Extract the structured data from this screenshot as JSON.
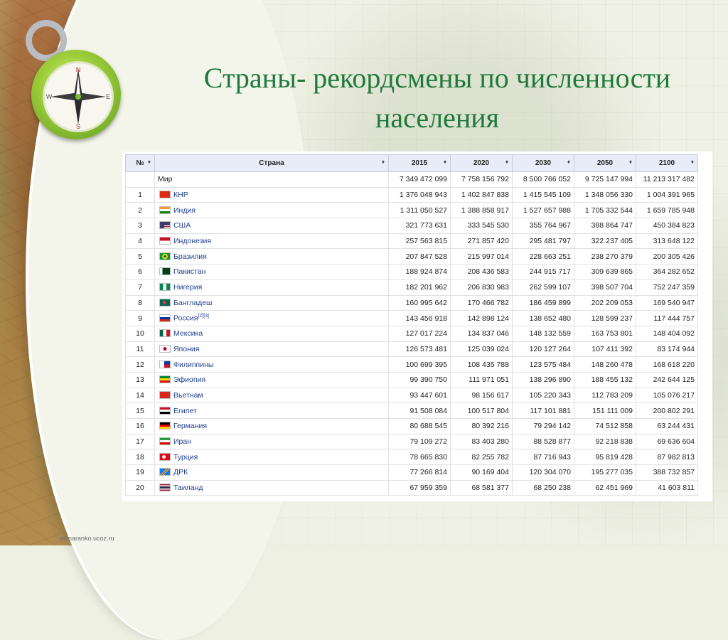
{
  "title_line1": "Страны- рекордсмены по численности",
  "title_line2": "населения",
  "footer_url": "elenaranko.ucoz.ru",
  "compass_letters": {
    "n": "N",
    "s": "S",
    "e": "E",
    "w": "W"
  },
  "table": {
    "headers": {
      "num": "№",
      "country": "Страна",
      "y2015": "2015",
      "y2020": "2020",
      "y2030": "2030",
      "y2050": "2050",
      "y2100": "2100"
    },
    "world": {
      "name": "Мир",
      "values": [
        "7 349 472 099",
        "7 758 156 792",
        "8 500 766 052",
        "9 725 147 994",
        "11 213 317 482"
      ]
    },
    "rows": [
      {
        "num": "1",
        "name": "КНР",
        "flag": "china",
        "values": [
          "1 376 048 943",
          "1 402 847 838",
          "1 415 545 109",
          "1 348 056 330",
          "1 004 391 965"
        ]
      },
      {
        "num": "2",
        "name": "Индия",
        "flag": "india",
        "values": [
          "1 311 050 527",
          "1 388 858 917",
          "1 527 657 988",
          "1 705 332 544",
          "1 659 785 948"
        ]
      },
      {
        "num": "3",
        "name": "США",
        "flag": "usa",
        "values": [
          "321 773 631",
          "333 545 530",
          "355 764 967",
          "388 864 747",
          "450 384 823"
        ]
      },
      {
        "num": "4",
        "name": "Индонезия",
        "flag": "indonesia",
        "values": [
          "257 563 815",
          "271 857 420",
          "295 481 797",
          "322 237 405",
          "313 648 122"
        ]
      },
      {
        "num": "5",
        "name": "Бразилия",
        "flag": "brazil",
        "values": [
          "207 847 528",
          "215 997 014",
          "228 663 251",
          "238 270 379",
          "200 305 426"
        ]
      },
      {
        "num": "6",
        "name": "Пакистан",
        "flag": "pakistan",
        "values": [
          "188 924 874",
          "208 436 583",
          "244 915 717",
          "309 639 865",
          "364 282 652"
        ]
      },
      {
        "num": "7",
        "name": "Нигерия",
        "flag": "nigeria",
        "values": [
          "182 201 962",
          "206 830 983",
          "262 599 107",
          "398 507 704",
          "752 247 359"
        ]
      },
      {
        "num": "8",
        "name": "Бангладеш",
        "flag": "bangladesh",
        "values": [
          "160 995 642",
          "170 466 782",
          "186 459 899",
          "202 209 053",
          "169 540 947"
        ]
      },
      {
        "num": "9",
        "name": "Россия",
        "flag": "russia",
        "sup": "[2][3]",
        "values": [
          "143 456 918",
          "142 898 124",
          "138 652 480",
          "128 599 237",
          "117 444 757"
        ]
      },
      {
        "num": "10",
        "name": "Мексика",
        "flag": "mexico",
        "values": [
          "127 017 224",
          "134 837 046",
          "148 132 559",
          "163 753 801",
          "148 404 092"
        ]
      },
      {
        "num": "11",
        "name": "Япония",
        "flag": "japan",
        "values": [
          "126 573 481",
          "125 039 024",
          "120 127 264",
          "107 411 392",
          "83 174 944"
        ]
      },
      {
        "num": "12",
        "name": "Филиппины",
        "flag": "philippines",
        "values": [
          "100 699 395",
          "108 435 788",
          "123 575 484",
          "148 260 478",
          "168 618 220"
        ]
      },
      {
        "num": "13",
        "name": "Эфиопия",
        "flag": "ethiopia",
        "values": [
          "99 390 750",
          "111 971 051",
          "138 296 890",
          "188 455 132",
          "242 644 125"
        ]
      },
      {
        "num": "14",
        "name": "Вьетнам",
        "flag": "vietnam",
        "values": [
          "93 447 601",
          "98 156 617",
          "105 220 343",
          "112 783 209",
          "105 076 217"
        ]
      },
      {
        "num": "15",
        "name": "Египет",
        "flag": "egypt",
        "values": [
          "91 508 084",
          "100 517 804",
          "117 101 881",
          "151 111 009",
          "200 802 291"
        ]
      },
      {
        "num": "16",
        "name": "Германия",
        "flag": "germany",
        "values": [
          "80 688 545",
          "80 392 216",
          "79 294 142",
          "74 512 858",
          "63 244 431"
        ]
      },
      {
        "num": "17",
        "name": "Иран",
        "flag": "iran",
        "values": [
          "79 109 272",
          "83 403 280",
          "88 528 877",
          "92 218 838",
          "69 636 604"
        ]
      },
      {
        "num": "18",
        "name": "Турция",
        "flag": "turkey",
        "values": [
          "78 665 830",
          "82 255 782",
          "87 716 943",
          "95 819 428",
          "87 982 813"
        ]
      },
      {
        "num": "19",
        "name": "ДРК",
        "flag": "drc",
        "values": [
          "77 266 814",
          "90 169 404",
          "120 304 070",
          "195 277 035",
          "388 732 857"
        ]
      },
      {
        "num": "20",
        "name": "Таиланд",
        "flag": "thailand",
        "values": [
          "67 959 359",
          "68 581 377",
          "68 250 238",
          "62 451 969",
          "41 603 811"
        ]
      }
    ]
  }
}
